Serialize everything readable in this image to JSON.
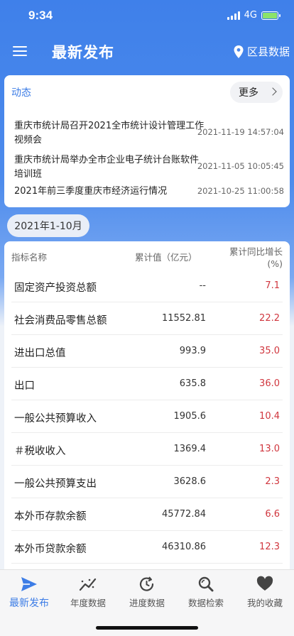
{
  "status": {
    "time": "9:34",
    "network": "4G"
  },
  "nav": {
    "title": "最新发布",
    "right_label": "区县数据"
  },
  "news": {
    "heading": "动态",
    "more_label": "更多",
    "items": [
      {
        "title": "重庆市统计局召开2021全市统计设计管理工作视频会",
        "time": "2021-11-19 14:57:04"
      },
      {
        "title": "重庆市统计局举办全市企业电子统计台账软件培训班",
        "time": "2021-11-05 10:05:45"
      },
      {
        "title": "2021年前三季度重庆市经济运行情况",
        "time": "2021-10-25 11:00:58"
      }
    ]
  },
  "period": "2021年1-10月",
  "table": {
    "headers": {
      "name": "指标名称",
      "value": "累计值（亿元）",
      "rate_line1": "累计同比增长",
      "rate_line2": "(%)"
    },
    "rows": [
      {
        "name": "固定资产投资总额",
        "value": "--",
        "rate": "7.1"
      },
      {
        "name": "社会消费品零售总额",
        "value": "11552.81",
        "rate": "22.2"
      },
      {
        "name": "进出口总值",
        "value": "993.9",
        "rate": "35.0"
      },
      {
        "name": "出口",
        "value": "635.8",
        "rate": "36.0"
      },
      {
        "name": "一般公共预算收入",
        "value": "1905.6",
        "rate": "10.4"
      },
      {
        "name": "＃税收收入",
        "value": "1369.4",
        "rate": "13.0"
      },
      {
        "name": "一般公共预算支出",
        "value": "3628.6",
        "rate": "2.3"
      },
      {
        "name": "本外币存款余额",
        "value": "45772.84",
        "rate": "6.6"
      },
      {
        "name": "本外币贷款余额",
        "value": "46310.86",
        "rate": "12.3"
      }
    ]
  },
  "tabs": [
    {
      "label": "最新发布",
      "icon": "send-icon",
      "active": true
    },
    {
      "label": "年度数据",
      "icon": "trend-icon",
      "active": false
    },
    {
      "label": "进度数据",
      "icon": "refresh-clock-icon",
      "active": false
    },
    {
      "label": "数据检索",
      "icon": "search-icon",
      "active": false
    },
    {
      "label": "我的收藏",
      "icon": "heart-icon",
      "active": false
    }
  ],
  "colors": {
    "primary": "#3d7de6",
    "positive": "#d0363e"
  }
}
